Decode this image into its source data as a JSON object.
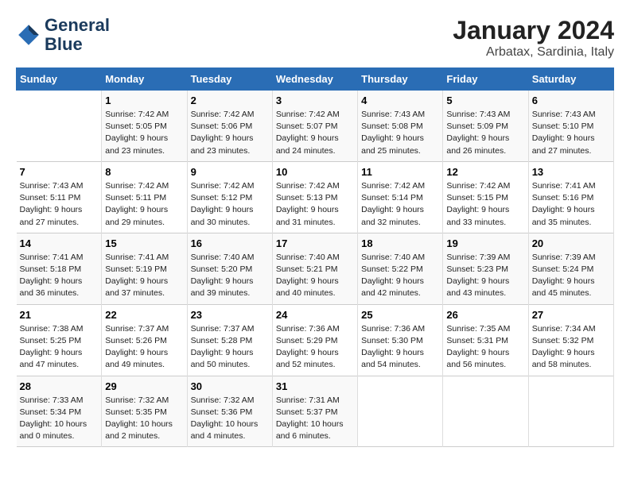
{
  "logo": {
    "line1": "General",
    "line2": "Blue"
  },
  "title": "January 2024",
  "subtitle": "Arbatax, Sardinia, Italy",
  "columns": [
    "Sunday",
    "Monday",
    "Tuesday",
    "Wednesday",
    "Thursday",
    "Friday",
    "Saturday"
  ],
  "weeks": [
    [
      {
        "day": "",
        "sunrise": "",
        "sunset": "",
        "daylight": ""
      },
      {
        "day": "1",
        "sunrise": "Sunrise: 7:42 AM",
        "sunset": "Sunset: 5:05 PM",
        "daylight": "Daylight: 9 hours and 23 minutes."
      },
      {
        "day": "2",
        "sunrise": "Sunrise: 7:42 AM",
        "sunset": "Sunset: 5:06 PM",
        "daylight": "Daylight: 9 hours and 23 minutes."
      },
      {
        "day": "3",
        "sunrise": "Sunrise: 7:42 AM",
        "sunset": "Sunset: 5:07 PM",
        "daylight": "Daylight: 9 hours and 24 minutes."
      },
      {
        "day": "4",
        "sunrise": "Sunrise: 7:43 AM",
        "sunset": "Sunset: 5:08 PM",
        "daylight": "Daylight: 9 hours and 25 minutes."
      },
      {
        "day": "5",
        "sunrise": "Sunrise: 7:43 AM",
        "sunset": "Sunset: 5:09 PM",
        "daylight": "Daylight: 9 hours and 26 minutes."
      },
      {
        "day": "6",
        "sunrise": "Sunrise: 7:43 AM",
        "sunset": "Sunset: 5:10 PM",
        "daylight": "Daylight: 9 hours and 27 minutes."
      }
    ],
    [
      {
        "day": "7",
        "sunrise": "Sunrise: 7:43 AM",
        "sunset": "Sunset: 5:11 PM",
        "daylight": "Daylight: 9 hours and 27 minutes."
      },
      {
        "day": "8",
        "sunrise": "Sunrise: 7:42 AM",
        "sunset": "Sunset: 5:11 PM",
        "daylight": "Daylight: 9 hours and 29 minutes."
      },
      {
        "day": "9",
        "sunrise": "Sunrise: 7:42 AM",
        "sunset": "Sunset: 5:12 PM",
        "daylight": "Daylight: 9 hours and 30 minutes."
      },
      {
        "day": "10",
        "sunrise": "Sunrise: 7:42 AM",
        "sunset": "Sunset: 5:13 PM",
        "daylight": "Daylight: 9 hours and 31 minutes."
      },
      {
        "day": "11",
        "sunrise": "Sunrise: 7:42 AM",
        "sunset": "Sunset: 5:14 PM",
        "daylight": "Daylight: 9 hours and 32 minutes."
      },
      {
        "day": "12",
        "sunrise": "Sunrise: 7:42 AM",
        "sunset": "Sunset: 5:15 PM",
        "daylight": "Daylight: 9 hours and 33 minutes."
      },
      {
        "day": "13",
        "sunrise": "Sunrise: 7:41 AM",
        "sunset": "Sunset: 5:16 PM",
        "daylight": "Daylight: 9 hours and 35 minutes."
      }
    ],
    [
      {
        "day": "14",
        "sunrise": "Sunrise: 7:41 AM",
        "sunset": "Sunset: 5:18 PM",
        "daylight": "Daylight: 9 hours and 36 minutes."
      },
      {
        "day": "15",
        "sunrise": "Sunrise: 7:41 AM",
        "sunset": "Sunset: 5:19 PM",
        "daylight": "Daylight: 9 hours and 37 minutes."
      },
      {
        "day": "16",
        "sunrise": "Sunrise: 7:40 AM",
        "sunset": "Sunset: 5:20 PM",
        "daylight": "Daylight: 9 hours and 39 minutes."
      },
      {
        "day": "17",
        "sunrise": "Sunrise: 7:40 AM",
        "sunset": "Sunset: 5:21 PM",
        "daylight": "Daylight: 9 hours and 40 minutes."
      },
      {
        "day": "18",
        "sunrise": "Sunrise: 7:40 AM",
        "sunset": "Sunset: 5:22 PM",
        "daylight": "Daylight: 9 hours and 42 minutes."
      },
      {
        "day": "19",
        "sunrise": "Sunrise: 7:39 AM",
        "sunset": "Sunset: 5:23 PM",
        "daylight": "Daylight: 9 hours and 43 minutes."
      },
      {
        "day": "20",
        "sunrise": "Sunrise: 7:39 AM",
        "sunset": "Sunset: 5:24 PM",
        "daylight": "Daylight: 9 hours and 45 minutes."
      }
    ],
    [
      {
        "day": "21",
        "sunrise": "Sunrise: 7:38 AM",
        "sunset": "Sunset: 5:25 PM",
        "daylight": "Daylight: 9 hours and 47 minutes."
      },
      {
        "day": "22",
        "sunrise": "Sunrise: 7:37 AM",
        "sunset": "Sunset: 5:26 PM",
        "daylight": "Daylight: 9 hours and 49 minutes."
      },
      {
        "day": "23",
        "sunrise": "Sunrise: 7:37 AM",
        "sunset": "Sunset: 5:28 PM",
        "daylight": "Daylight: 9 hours and 50 minutes."
      },
      {
        "day": "24",
        "sunrise": "Sunrise: 7:36 AM",
        "sunset": "Sunset: 5:29 PM",
        "daylight": "Daylight: 9 hours and 52 minutes."
      },
      {
        "day": "25",
        "sunrise": "Sunrise: 7:36 AM",
        "sunset": "Sunset: 5:30 PM",
        "daylight": "Daylight: 9 hours and 54 minutes."
      },
      {
        "day": "26",
        "sunrise": "Sunrise: 7:35 AM",
        "sunset": "Sunset: 5:31 PM",
        "daylight": "Daylight: 9 hours and 56 minutes."
      },
      {
        "day": "27",
        "sunrise": "Sunrise: 7:34 AM",
        "sunset": "Sunset: 5:32 PM",
        "daylight": "Daylight: 9 hours and 58 minutes."
      }
    ],
    [
      {
        "day": "28",
        "sunrise": "Sunrise: 7:33 AM",
        "sunset": "Sunset: 5:34 PM",
        "daylight": "Daylight: 10 hours and 0 minutes."
      },
      {
        "day": "29",
        "sunrise": "Sunrise: 7:32 AM",
        "sunset": "Sunset: 5:35 PM",
        "daylight": "Daylight: 10 hours and 2 minutes."
      },
      {
        "day": "30",
        "sunrise": "Sunrise: 7:32 AM",
        "sunset": "Sunset: 5:36 PM",
        "daylight": "Daylight: 10 hours and 4 minutes."
      },
      {
        "day": "31",
        "sunrise": "Sunrise: 7:31 AM",
        "sunset": "Sunset: 5:37 PM",
        "daylight": "Daylight: 10 hours and 6 minutes."
      },
      {
        "day": "",
        "sunrise": "",
        "sunset": "",
        "daylight": ""
      },
      {
        "day": "",
        "sunrise": "",
        "sunset": "",
        "daylight": ""
      },
      {
        "day": "",
        "sunrise": "",
        "sunset": "",
        "daylight": ""
      }
    ]
  ]
}
